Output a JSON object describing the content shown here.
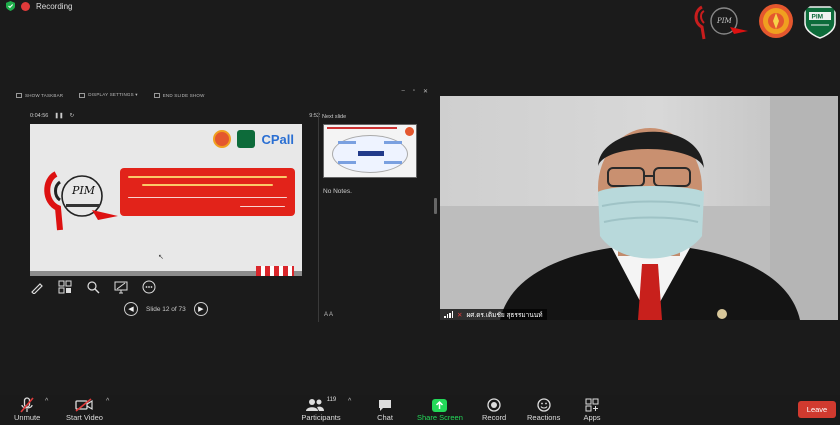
{
  "status": {
    "recording_label": "Recording"
  },
  "share": {
    "toolbar": {
      "show_taskbar": "SHOW TASKBAR",
      "display_settings": "DISPLAY SETTINGS ▾",
      "end_slide_show": "END SLIDE SHOW"
    },
    "elapsed_time": "0:04:56",
    "clock": "9:52",
    "next_slide_label": "Next slide",
    "notes_text": "No Notes.",
    "slide_counter": "Slide 12 of 73",
    "notes_font_controls": "A  A",
    "slide": {
      "brand_text": "CPall",
      "pim_text": "PIM"
    }
  },
  "video": {
    "participant_name": "ผศ.ดร.เติมชัย  สุธรรมานนท์"
  },
  "toolbar": {
    "unmute_label": "Unmute",
    "start_video_label": "Start Video",
    "participants_label": "Participants",
    "participants_count": "119",
    "chat_label": "Chat",
    "share_screen_label": "Share Screen",
    "record_label": "Record",
    "reactions_label": "Reactions",
    "apps_label": "Apps",
    "leave_label": "Leave"
  },
  "colors": {
    "share_screen_green": "#23d959",
    "leave_red": "#d13a2f",
    "recording_red": "#e03a3a"
  }
}
